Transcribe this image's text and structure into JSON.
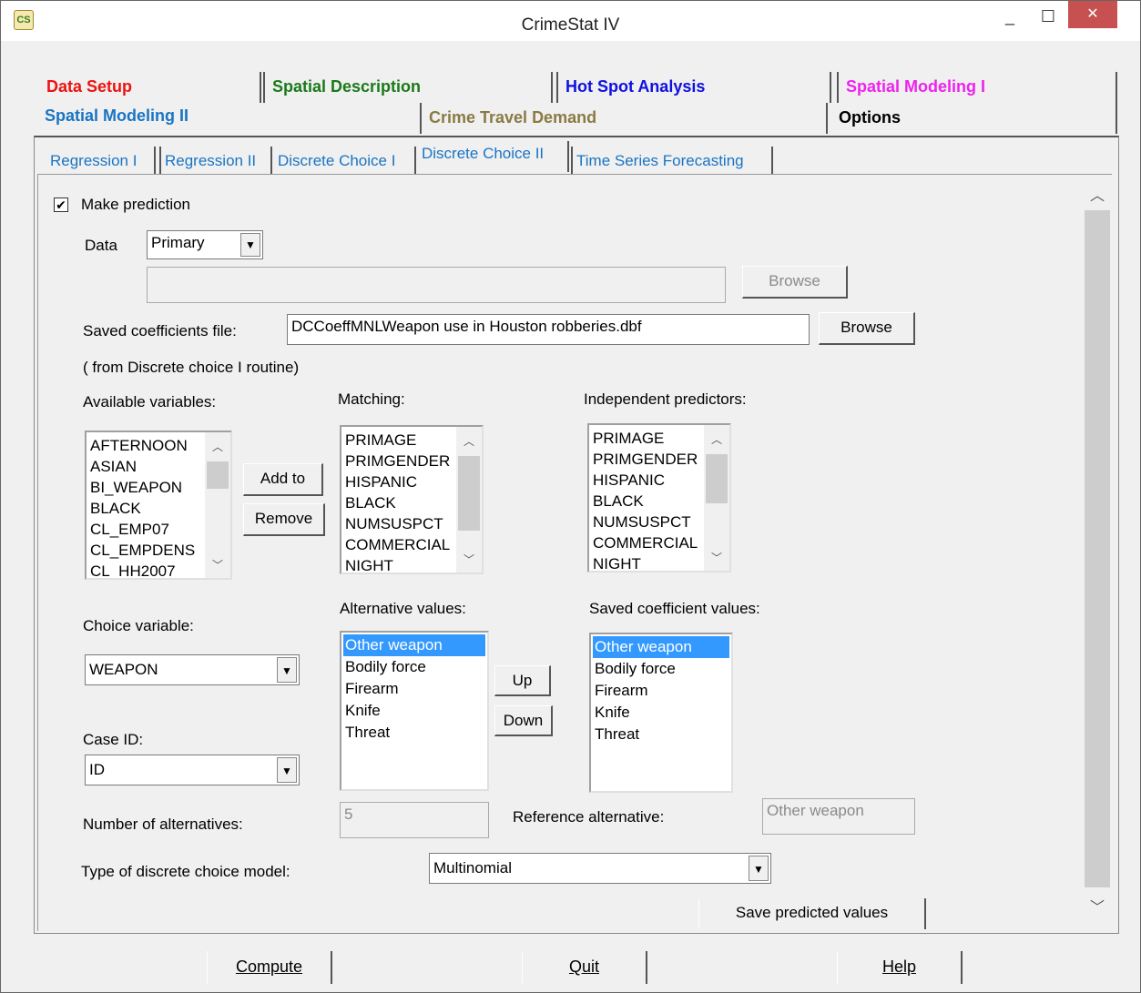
{
  "window": {
    "title": "CrimeStat IV",
    "minimize": "_",
    "maximize": "☐",
    "close": "✕",
    "icon_label": "CS"
  },
  "main_tabs": {
    "data_setup": "Data Setup",
    "spatial_description": "Spatial Description",
    "hot_spot_analysis": "Hot Spot Analysis",
    "spatial_modeling_1": "Spatial Modeling I",
    "spatial_modeling_2": "Spatial Modeling II",
    "crime_travel_demand": "Crime Travel Demand",
    "options": "Options",
    "colors": {
      "data_setup": "#ee1111",
      "spatial_description": "#1a7a1a",
      "hot_spot_analysis": "#1010e0",
      "spatial_modeling_1": "#ee22ee",
      "spatial_modeling_2": "#1a74c4",
      "crime_travel_demand": "#8a7a44",
      "options": "#000000"
    }
  },
  "sub_tabs": [
    "Regression I",
    "Regression II",
    "Discrete Choice I",
    "Discrete Choice II",
    "Time Series Forecasting"
  ],
  "form": {
    "make_prediction_label": "Make prediction",
    "make_prediction_checked": "✔",
    "data_label": "Data",
    "data_value": "Primary",
    "data_file_value": "",
    "browse_disabled": "Browse",
    "saved_coeff_label": "Saved coefficients file:",
    "saved_coeff_value": "DCCoeffMNLWeapon use in Houston robberies.dbf",
    "browse": "Browse",
    "from_note": "( from Discrete choice I routine)",
    "available_label": "Available variables:",
    "available_items": [
      "AFTERNOON",
      "ASIAN",
      "BI_WEAPON",
      "BLACK",
      "CL_EMP07",
      "CL_EMPDENS",
      "CL_HH2007"
    ],
    "add_to": "Add to",
    "remove": "Remove",
    "matching_label": "Matching:",
    "matching_items": [
      "PRIMAGE",
      "PRIMGENDER",
      "HISPANIC",
      "BLACK",
      "NUMSUSPCT",
      "COMMERCIAL",
      "NIGHT"
    ],
    "predictors_label": "Independent predictors:",
    "predictors_items": [
      "PRIMAGE",
      "PRIMGENDER",
      "HISPANIC",
      "BLACK",
      "NUMSUSPCT",
      "COMMERCIAL",
      "NIGHT"
    ],
    "choice_label": "Choice variable:",
    "choice_value": "WEAPON",
    "alt_values_label": "Alternative values:",
    "alt_values_items": [
      "Other weapon",
      "Bodily force",
      "Firearm",
      "Knife",
      "Threat"
    ],
    "up": "Up",
    "down": "Down",
    "saved_coeff_values_label": "Saved coefficient values:",
    "saved_coeff_values_items": [
      "Other weapon",
      "Bodily force",
      "Firearm",
      "Knife",
      "Threat"
    ],
    "case_id_label": "Case ID:",
    "case_id_value": "ID",
    "num_alt_label": "Number of alternatives:",
    "num_alt_value": "5",
    "ref_alt_label": "Reference alternative:",
    "ref_alt_value": "Other weapon",
    "model_type_label": "Type of discrete choice model:",
    "model_type_value": "Multinomial",
    "save_predicted": "Save predicted values"
  },
  "bottom": {
    "compute": "Compute",
    "quit": "Quit",
    "help": "Help"
  }
}
